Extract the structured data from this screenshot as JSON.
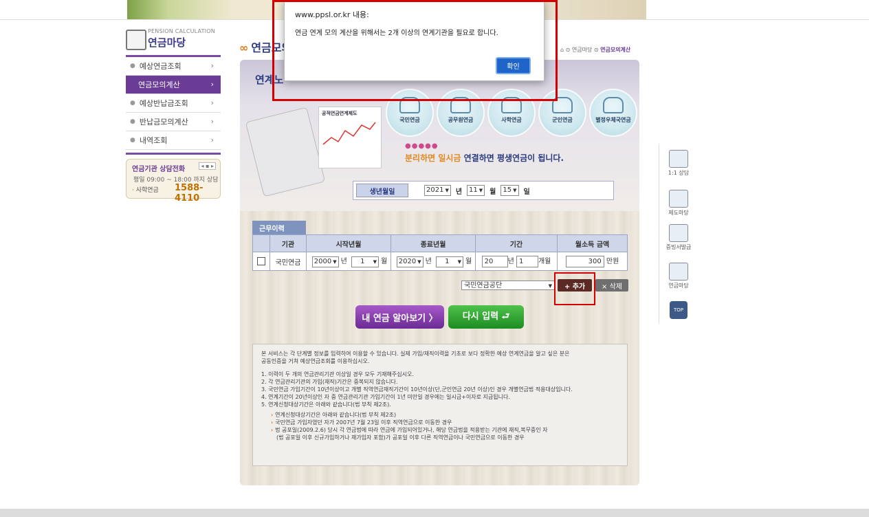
{
  "dialog": {
    "title": "www.ppsl.or.kr 내용:",
    "message": "연금 연계 모의 계산을 위해서는 2개 이상의 연계기관을 필요로 합니다.",
    "ok_label": "확인"
  },
  "brand": {
    "subtitle": "PENSION CALCULATION",
    "title": "연금마당"
  },
  "nav": {
    "items": [
      {
        "label": "예상연금조회"
      },
      {
        "label": "연금모의계산"
      },
      {
        "label": "예상반납금조회"
      },
      {
        "label": "반납금모의계산"
      },
      {
        "label": "내역조회"
      }
    ]
  },
  "contact": {
    "title": "연금기관 상담전화",
    "hours": "평일  09:00 ~ 18:00  까지 상담",
    "label": "· 사학연금",
    "phone": "1588-4110"
  },
  "page": {
    "title": "연금모의계산"
  },
  "breadcrumb": {
    "home": "⌂ ⊙ 연금마당 ⊙",
    "current": "연금모의계산"
  },
  "panel": {
    "heading": "연계노",
    "paper_label": "공적연금연계제도",
    "agencies": [
      "국민연금",
      "공무원연금",
      "사학연금",
      "군인연금",
      "별정우체국연금"
    ],
    "slogan_dots": "●●●●●",
    "slogan_a": "분리하면 일시금 ",
    "slogan_b": "연결하면 평생연금이 됩니다."
  },
  "birth": {
    "label": "생년월일",
    "year": "2021",
    "year_unit": "년",
    "month": "11",
    "month_unit": "월",
    "day": "15",
    "day_unit": "일"
  },
  "work": {
    "tab_label": "근무이력",
    "headers": [
      "기관",
      "시작년월",
      "종료년월",
      "기간",
      "월소득 금액"
    ],
    "row": {
      "agency": "국민연금",
      "start_year": "2000",
      "start_month": "1",
      "end_year": "2020",
      "end_month": "1",
      "years": "20",
      "months": "1",
      "income": "300",
      "y_unit": "년",
      "m_unit": "월",
      "years_unit": "년",
      "months_unit": "개월",
      "income_unit": "만원"
    }
  },
  "controls": {
    "agency_select": "국민연금공단",
    "add_label": "+ 추가",
    "delete_label": "× 삭제",
    "calc_label": "내 연금 알아보기  〉",
    "reset_label": "다시 입력   ⮐"
  },
  "info": {
    "intro1": "본 서비스는 각 단계별 정보를 입력하여 이용할 수 있습니다. 실제 가입/재직이력을 기초로 보다  정확한 예상 연계연금을 알고 싶은 분은",
    "intro2": "공동인증을 거쳐 예상연금조회를 이용하십시오.",
    "items": [
      "1. 이력이 두 개의 연금관리기관 이상일 경우 모두 기재해주십시오.",
      "2. 각 연금관리기관의 가입(재직)기간은 중복되지 않습니다.",
      "3. 국민연금 가입기간이 10년이상이고 개별 직역연금재직기간이 10년이상(단,군인연금 20년 이상)인 경우 개별연금법 적용대상입니다.",
      "4. 연계기간이 20년이상인 자 중 연금관리기관 가입기간이 1년 미만일 경우에는 일시금+이자로 지급됩니다.",
      "5. 연계신청대상기간은 아래와 같습니다(법 부칙 제2조)."
    ],
    "sub": [
      "연계신청대상기간은 아래와 같습니다(법 부칙 제2조)",
      "국민연금 가입자였던 자가 2007년 7월 23일 이후 직역연금으로 이동한 경우",
      "법 공포일(2009.2.6) 당시 각 연금법에 따라 연금에 가입되어있거나, 해당 연금법을 적용받는 기관에 재직,복무중인 자",
      "(법 공포일 이후 신규가입하거나 재가입자 포함)가 공포일 이후 다른 직역연금이나 국민연금으로 이동한 경우"
    ]
  },
  "side": {
    "items": [
      {
        "label": "1:1 상담"
      },
      {
        "label": "제도마당"
      },
      {
        "label": "증빙서발급"
      },
      {
        "label": "연금마당"
      },
      {
        "label": "TOP"
      }
    ]
  }
}
